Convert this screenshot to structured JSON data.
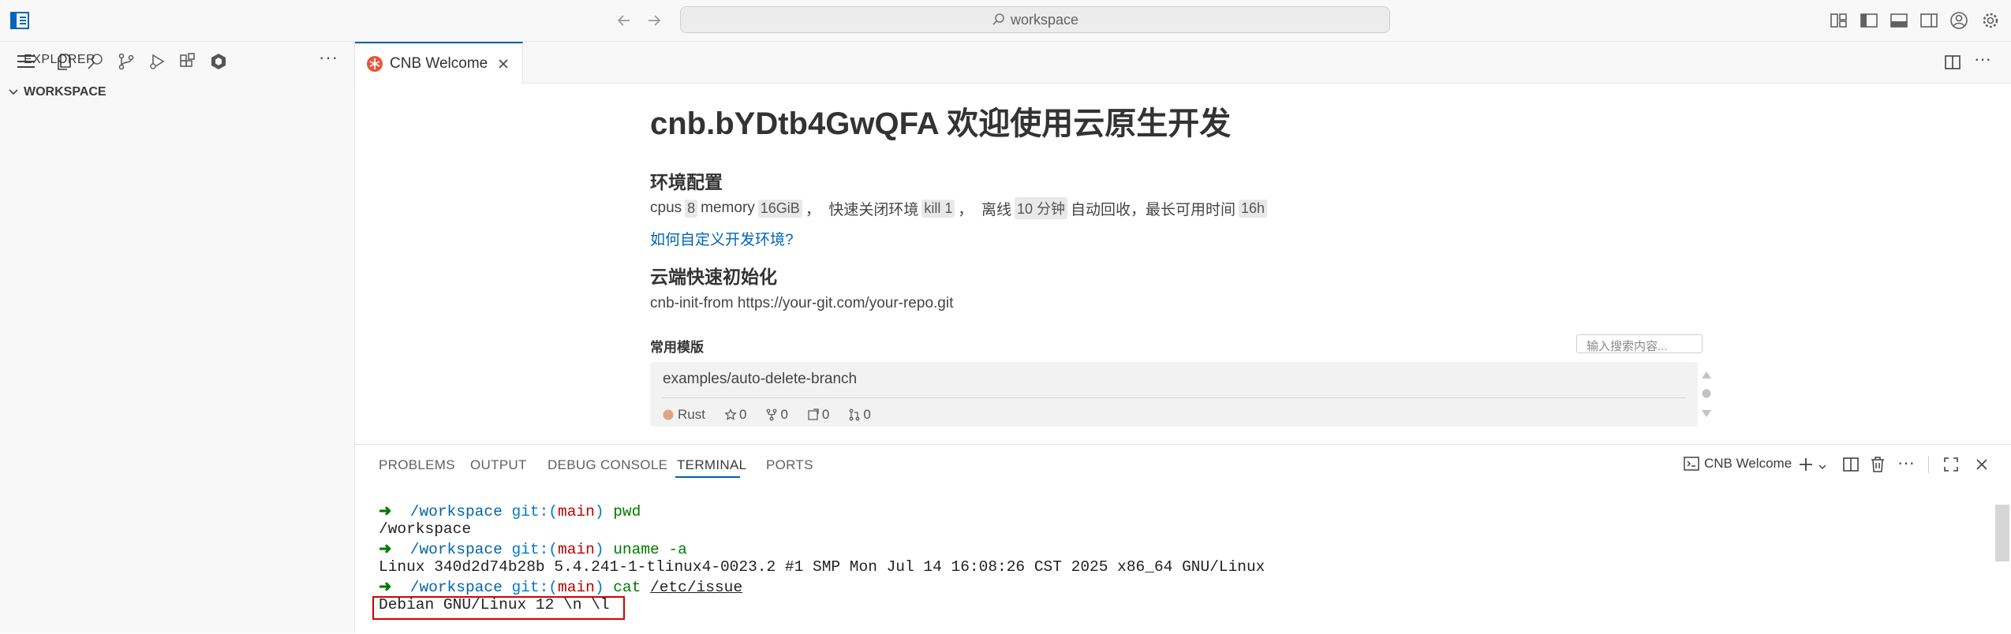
{
  "titlebar": {
    "search_placeholder": "workspace"
  },
  "sidebar": {
    "title": "EXPLORER",
    "more": "···",
    "workspace": "WORKSPACE"
  },
  "editor": {
    "tab_label": "CNB Welcome",
    "title": "cnb.bYDtb4GwQFA 欢迎使用云原生开发",
    "env_heading": "环境配置",
    "env": {
      "cpus_label": "cpus",
      "cpus_value": "8",
      "memory_label": "memory",
      "memory_value": "16GiB",
      "quick_close_label": "，  快速关闭环境",
      "quick_close_value": "kill 1",
      "offline_label": "，  离线",
      "offline_value": "10 分钟",
      "auto_recycle_label": "自动回收，最长可用时间",
      "max_time_value": "16h"
    },
    "custom_link": "如何自定义开发环境?",
    "init_heading": "云端快速初始化",
    "init_command": "cnb-init-from https://your-git.com/your-repo.git",
    "templates_label": "常用模版",
    "templates_search_placeholder": "输入搜索内容...",
    "template": {
      "name": "examples/auto-delete-branch",
      "language": "Rust",
      "language_color": "#dea584",
      "stars": "0",
      "forks": "0",
      "issues": "0",
      "prs": "0"
    }
  },
  "panel": {
    "tabs": [
      "PROBLEMS",
      "OUTPUT",
      "DEBUG CONSOLE",
      "TERMINAL",
      "PORTS"
    ],
    "terminal_name": "CNB Welcome",
    "terminal": {
      "prompt_path": "/workspace",
      "git_label": "git:(",
      "branch": "main",
      "git_close": ")",
      "cmd1": "pwd",
      "out1": "/workspace",
      "cmd2": "uname -a",
      "out2": "Linux 340d2d74b28b 5.4.241-1-tlinux4-0023.2 #1 SMP Mon Jul 14 16:08:26 CST 2025 x86_64 GNU/Linux",
      "cmd3_a": "cat",
      "cmd3_b": "/etc/issue",
      "out3": "Debian GNU/Linux 12 \\n \\l"
    }
  },
  "colors": {
    "accent": "#005fb8",
    "highlight": "#d40000"
  }
}
